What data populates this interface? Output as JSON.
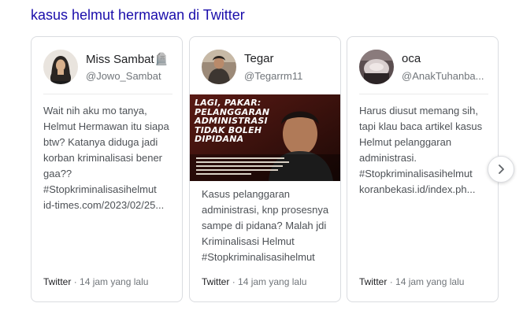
{
  "section": {
    "title": "kasus helmut hermawan di Twitter"
  },
  "cards": [
    {
      "author": "Miss Sambat🪦",
      "handle": "@Jowo_Sambat",
      "text_lines": [
        "Wait nih aku mo tanya,",
        "Helmut Hermawan itu siapa",
        "btw? Katanya diduga jadi",
        "korban kriminalisasi bener",
        "gaa??",
        "#Stopkriminalisasihelmut",
        "id-times.com/2023/02/25..."
      ],
      "source": "Twitter",
      "separator": "·",
      "time": "14 jam yang lalu"
    },
    {
      "author": "Tegar",
      "handle": "@Tegarrm11",
      "media": {
        "headline_lines": [
          "LAGI, PAKAR:",
          "PELANGGARAN",
          "ADMINISTRASI",
          "TIDAK BOLEH",
          "DIPIDANA"
        ]
      },
      "text_lines": [
        "Kasus pelanggaran",
        "administrasi, knp prosesnya",
        "sampe di pidana? Malah jdi",
        "Kriminalisasi Helmut",
        "#Stopkriminalisasihelmut"
      ],
      "source": "Twitter",
      "separator": "·",
      "time": "14 jam yang lalu"
    },
    {
      "author": "oca",
      "handle": "@AnakTuhanba...",
      "text_lines": [
        "Harus diusut memang sih,",
        "tapi klau baca artikel kasus",
        "Helmut pelanggaran",
        "administrasi.",
        "#Stopkriminalisasihelmut",
        "koranbekasi.id/index.ph..."
      ],
      "source": "Twitter",
      "separator": "·",
      "time": "14 jam yang lalu"
    }
  ],
  "next_button": {
    "icon": "chevron-right-icon"
  },
  "colors": {
    "title_link": "#1a0dab",
    "border": "#dadce0",
    "muted": "#70757a",
    "body_text": "#4d5156"
  }
}
